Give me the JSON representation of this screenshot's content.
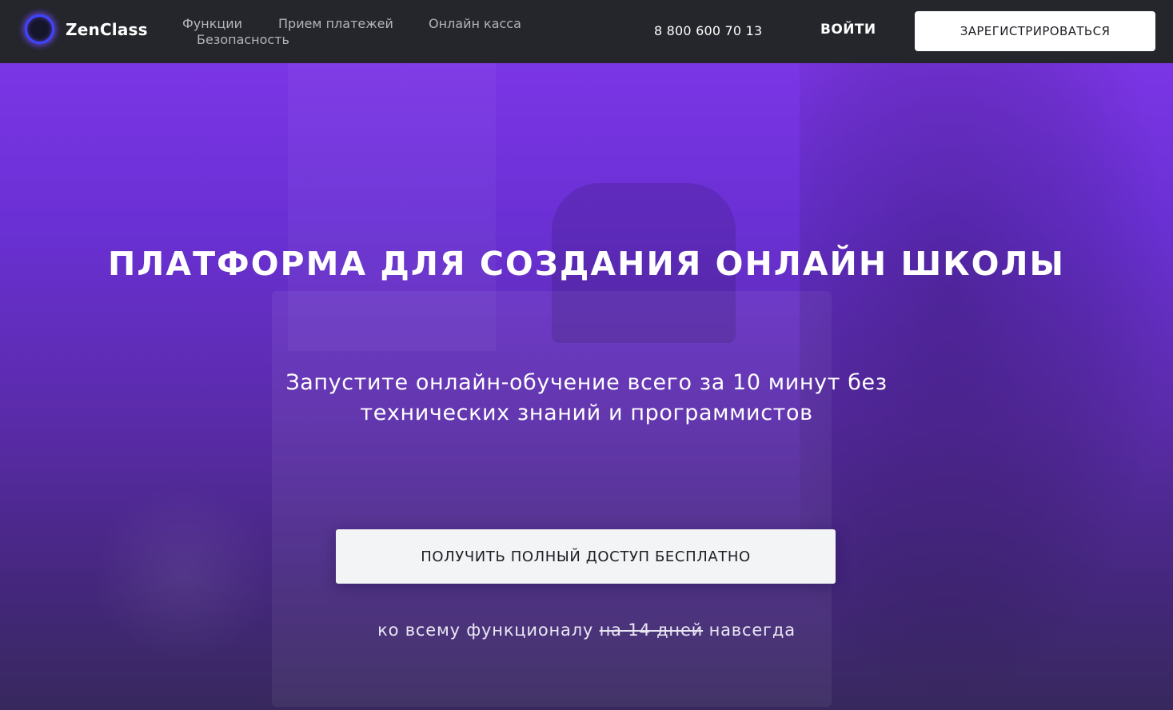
{
  "header": {
    "logo_text": "ZenClass",
    "nav": [
      "Функции",
      "Прием платежей",
      "Онлайн касса",
      "Безопасность"
    ],
    "phone": "8 800 600 70 13",
    "login_label": "ВОЙТИ",
    "register_label": "ЗАРЕГИСТРИРОВАТЬСЯ"
  },
  "hero": {
    "title": "ПЛАТФОРМА ДЛЯ СОЗДАНИЯ ОНЛАЙН ШКОЛЫ",
    "subtitle": "Запустите онлайн-обучение всего за 10 минут без технических знаний и программистов",
    "cta_label": "ПОЛУЧИТЬ ПОЛНЫЙ ДОСТУП БЕСПЛАТНО",
    "note_prefix": "ко всему функционалу",
    "note_struck": "на 14 дней",
    "note_suffix": "навсегда"
  },
  "colors": {
    "header_bg": "#24262b",
    "hero_top": "#7b35e5",
    "hero_bottom": "#37285d",
    "logo_ring": "#3b46ff"
  },
  "icons": {
    "logo": "glowing-ring-icon"
  }
}
